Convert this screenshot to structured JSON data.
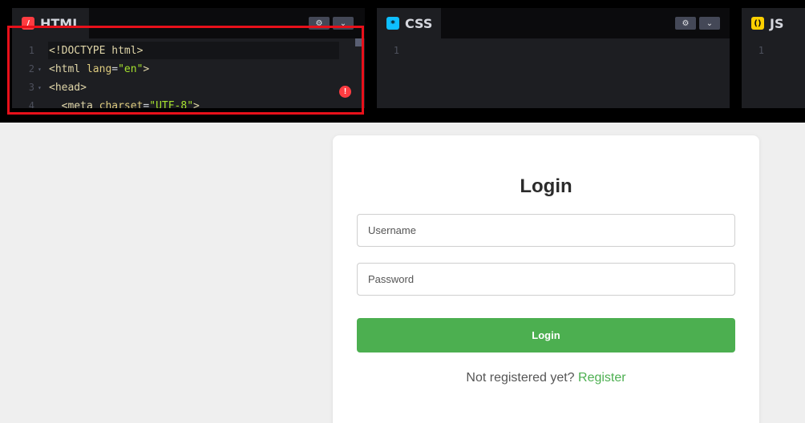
{
  "editor": {
    "html_panel": {
      "tab_label": "HTML",
      "icon": "html-icon",
      "lines": [
        {
          "num": "1",
          "parts": [
            {
              "cls": "t-tag",
              "text": "<!DOCTYPE html>"
            }
          ]
        },
        {
          "num": "2",
          "parts": [
            {
              "cls": "t-tag",
              "text": "<html "
            },
            {
              "cls": "t-attr",
              "text": "lang"
            },
            {
              "cls": "t-plain",
              "text": "="
            },
            {
              "cls": "t-str",
              "text": "\"en\""
            },
            {
              "cls": "t-tag",
              "text": ">"
            }
          ]
        },
        {
          "num": "3",
          "parts": [
            {
              "cls": "t-tag",
              "text": "<head>"
            }
          ]
        },
        {
          "num": "4",
          "parts": [
            {
              "cls": "t-tag",
              "text": "  <meta "
            },
            {
              "cls": "t-attr",
              "text": "charset"
            },
            {
              "cls": "t-plain",
              "text": "="
            },
            {
              "cls": "t-str",
              "text": "\"UTF-8\""
            },
            {
              "cls": "t-tag",
              "text": ">"
            }
          ]
        }
      ]
    },
    "css_panel": {
      "tab_label": "CSS",
      "icon": "css-icon",
      "lines": [
        {
          "num": "1"
        }
      ]
    },
    "js_panel": {
      "tab_label": "JS",
      "icon": "js-icon",
      "lines": [
        {
          "num": "1"
        }
      ]
    },
    "icons": {
      "settings": "⚙",
      "chevron": "⌄",
      "error": "!",
      "css_glyph": "*",
      "js_glyph": "()"
    }
  },
  "login_form": {
    "title": "Login",
    "username_placeholder": "Username",
    "password_placeholder": "Password",
    "submit_label": "Login",
    "register_prompt": "Not registered yet? ",
    "register_link": "Register"
  },
  "colors": {
    "accent_green": "#4caf50",
    "highlight_red": "#e8101a",
    "editor_bg": "#1d1e22"
  }
}
